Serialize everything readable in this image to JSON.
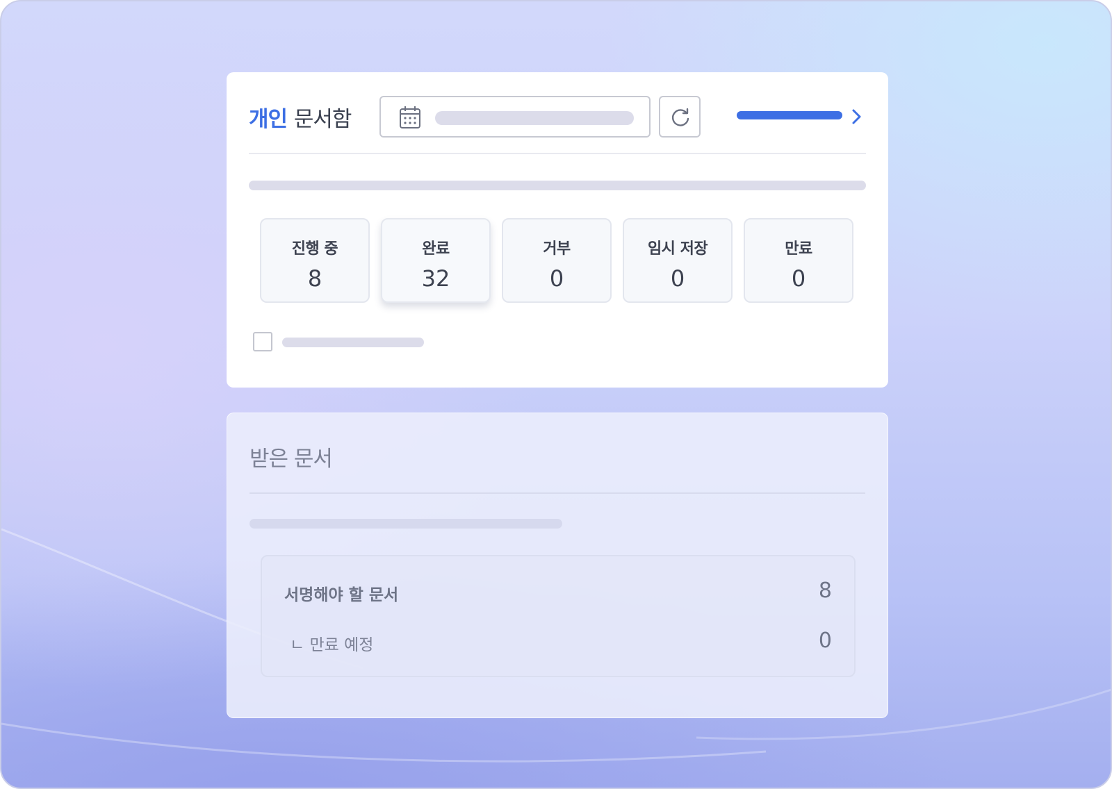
{
  "header": {
    "title_accent": "개인",
    "title_rest": "문서함"
  },
  "stats": [
    {
      "label": "진행 중",
      "value": "8"
    },
    {
      "label": "완료",
      "value": "32",
      "selected": true
    },
    {
      "label": "거부",
      "value": "0"
    },
    {
      "label": "임시 저장",
      "value": "0"
    },
    {
      "label": "만료",
      "value": "0"
    }
  ],
  "received": {
    "title": "받은 문서",
    "rows": [
      {
        "label": "서명해야 할 문서",
        "value": "8"
      },
      {
        "label": "ㄴ 만료 예정",
        "value": "0"
      }
    ]
  },
  "colors": {
    "accent": "#3d6fe4",
    "text": "#3d4250",
    "skeleton": "#dcdcea"
  },
  "icons": {
    "date": "calendar-icon",
    "refresh": "refresh-icon",
    "more": "chevron-right-icon",
    "select": "checkbox"
  }
}
